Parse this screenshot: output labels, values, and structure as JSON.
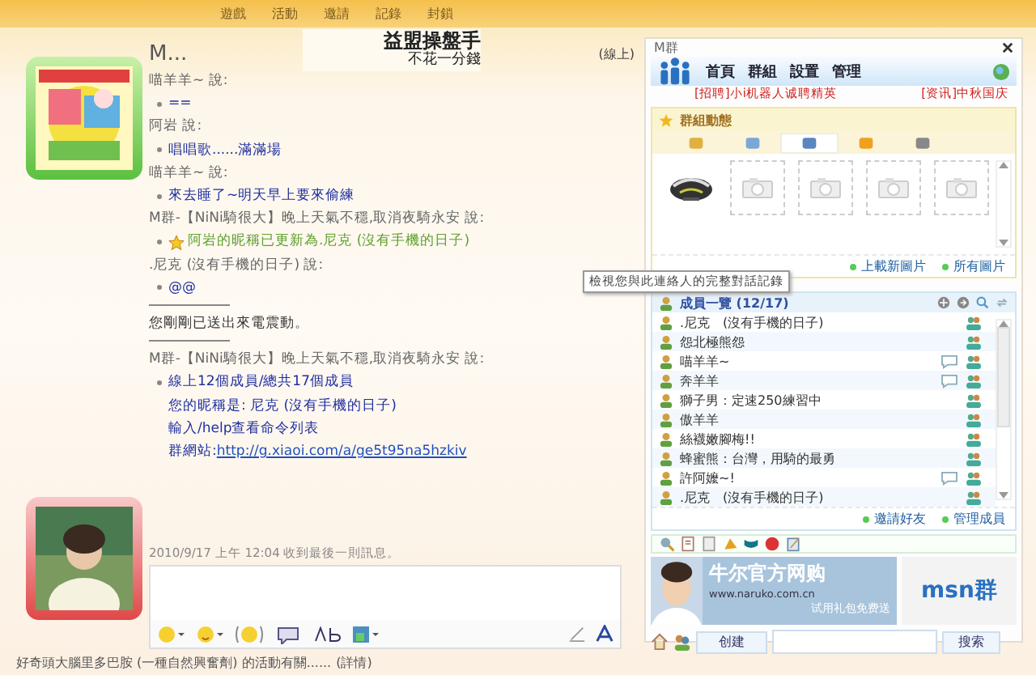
{
  "menu": [
    {
      "label": "遊戲"
    },
    {
      "label": "活動"
    },
    {
      "label": "邀請"
    },
    {
      "label": "記錄"
    },
    {
      "label": "封鎖"
    }
  ],
  "ad_banner": {
    "title": "益盟操盤手",
    "subtitle": "不花一分錢"
  },
  "chat": {
    "contact": "M...",
    "status": "(線上)",
    "messages": [
      {
        "kind": "sender",
        "text": "喵羊羊~ 說:"
      },
      {
        "kind": "bullet",
        "lines": [
          {
            "text": "=="
          }
        ]
      },
      {
        "kind": "sender",
        "text": "阿岩 說:"
      },
      {
        "kind": "bullet",
        "lines": [
          {
            "text": "唱唱歌......滿滿場"
          }
        ]
      },
      {
        "kind": "sender",
        "text": "喵羊羊~ 說:"
      },
      {
        "kind": "bullet",
        "lines": [
          {
            "text": "來去睡了~明天早上要來偷練"
          }
        ]
      },
      {
        "kind": "sender",
        "text": "M群-【NiNi騎很大】晚上天氣不穩,取消夜騎永安 說:"
      },
      {
        "kind": "notice",
        "text": "阿岩的昵稱已更新為.尼克 (沒有手機的日子)"
      },
      {
        "kind": "sender",
        "text": ".尼克 (沒有手機的日子) 說:"
      },
      {
        "kind": "bullet",
        "lines": [
          {
            "text": "@@"
          }
        ]
      },
      {
        "kind": "rule"
      },
      {
        "kind": "system",
        "text": "您剛剛已送出來電震動。"
      },
      {
        "kind": "rule"
      },
      {
        "kind": "sender",
        "text": "M群-【NiNi騎很大】晚上天氣不穩,取消夜騎永安 說:"
      },
      {
        "kind": "bullet",
        "lines": [
          {
            "text": "線上12個成員/總共17個成員"
          },
          {
            "text": "您的昵稱是: 尼克 (沒有手機的日子)"
          },
          {
            "text": "輸入/help查看命令列表"
          },
          {
            "text": "群網站: ",
            "link": "http://g.xiaoi.com/a/ge5t95na5hzkiv"
          }
        ]
      }
    ],
    "last_received": "2010/9/17 上午 12:04 收到最後一則訊息。",
    "tooltip": "檢視您與此連絡人的完整對話記錄"
  },
  "status_bar": {
    "text": "好奇頭大腦里多巴胺 (一種自然興奮劑) 的活動有關......",
    "link": "(詳情)"
  },
  "group_panel": {
    "title": "M群",
    "nav": [
      {
        "label": "首頁"
      },
      {
        "label": "群組"
      },
      {
        "label": "設置"
      },
      {
        "label": "管理"
      }
    ],
    "ticker": [
      "[招聘]小i机器人诚聘精英",
      "[资讯]中秋国庆"
    ],
    "activity": {
      "title": "群組動態",
      "tabs": [
        {
          "selected": false
        },
        {
          "selected": false
        },
        {
          "selected": true
        },
        {
          "selected": false
        },
        {
          "selected": false
        }
      ],
      "photos": [
        {
          "kind": "picture"
        },
        {
          "kind": "empty"
        },
        {
          "kind": "empty"
        },
        {
          "kind": "empty"
        },
        {
          "kind": "empty"
        }
      ],
      "links": [
        "上載新圖片",
        "所有圖片"
      ]
    },
    "members": {
      "title": "成員一覽 (12/17)",
      "items": [
        {
          "name": ".尼克　(沒有手機的日子)",
          "bubble": false
        },
        {
          "name": "怨北極熊怨",
          "bubble": false
        },
        {
          "name": "喵羊羊~",
          "bubble": true
        },
        {
          "name": "奔羊羊",
          "bubble": true
        },
        {
          "name": "獅子男：定速250練習中",
          "bubble": false
        },
        {
          "name": "傲羊羊",
          "bubble": false
        },
        {
          "name": "絲襪嫩腳梅!!",
          "bubble": false
        },
        {
          "name": "蜂蜜熊：台灣，用騎的最勇",
          "bubble": false
        },
        {
          "name": "許阿嬤~!",
          "bubble": true
        },
        {
          "name": ".尼克　(沒有手機的日子)",
          "bubble": false
        }
      ],
      "links": [
        "邀請好友",
        "管理成員"
      ]
    },
    "ad": {
      "title": "牛尔官方网购",
      "url": "www.naruko.com.cn",
      "tagline": "试用礼包免费送",
      "logo": "msn群"
    },
    "create_button": "创建",
    "search_button": "搜索"
  }
}
